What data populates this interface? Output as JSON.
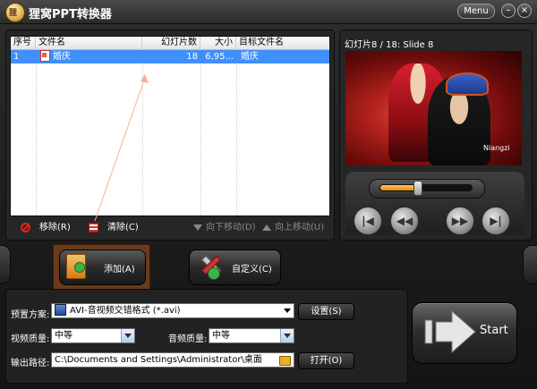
{
  "window": {
    "title": "狸窝PPT转换器",
    "logo_text": "狸",
    "menu_label": "Menu",
    "minimize_glyph": "–",
    "close_glyph": "×"
  },
  "file_list": {
    "columns": [
      "序号",
      "文件名",
      "幻灯片数",
      "大小",
      "目标文件名"
    ],
    "rows": [
      {
        "index": "1",
        "name": "婚庆",
        "slides": "18",
        "size": "6,95...",
        "target": "婚庆"
      }
    ]
  },
  "actions": {
    "remove": "移除(R)",
    "clear": "清除(C)",
    "move_down": "向下移动(D)",
    "move_up": "向上移动(U)"
  },
  "preview": {
    "slide_label": "幻灯片8 / 18: Slide 8",
    "watermark": "Niangzi",
    "seek_fraction": 0.4
  },
  "buttons": {
    "add": "添加(A)",
    "customize": "自定义(C)",
    "settings": "设置(S)",
    "open": "打开(O)",
    "start": "Start"
  },
  "settings": {
    "preset_label": "预置方案:",
    "preset_value": "AVI-音视频交错格式 (*.avi)",
    "video_quality_label": "视频质量:",
    "video_quality_value": "中等",
    "audio_quality_label": "音频质量:",
    "audio_quality_value": "中等",
    "output_path_label": "输出路径:",
    "output_path_value": "C:\\Documents and Settings\\Administrator\\桌面"
  },
  "colors": {
    "selection": "#3f8ffd",
    "seek_fill": "#f0a030",
    "add_highlight": "#6a3a1c"
  }
}
